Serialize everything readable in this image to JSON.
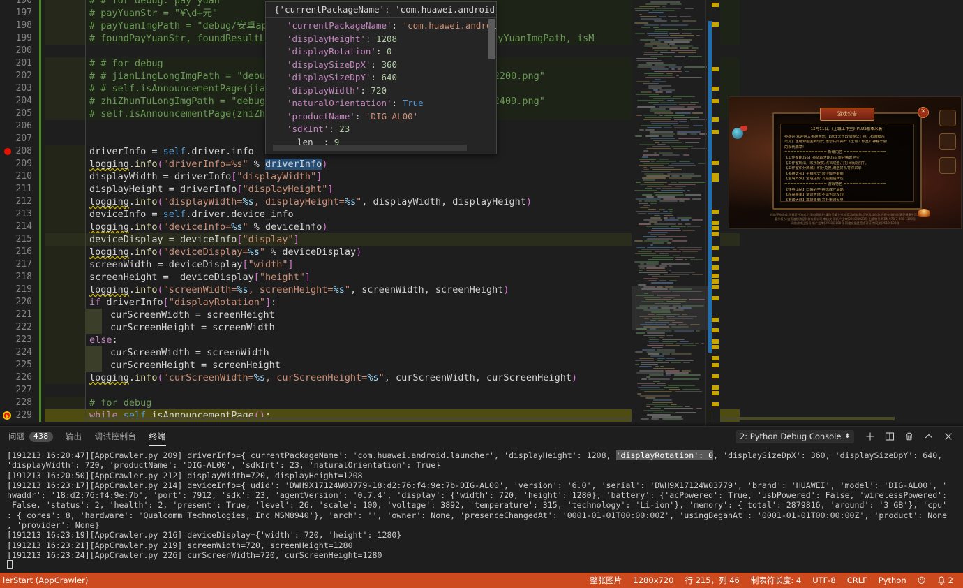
{
  "editor": {
    "first_line": 196,
    "current_line": 229,
    "breakpoint_lines": [
      208,
      229
    ],
    "lines": [
      {
        "n": 196,
        "tokens": [
          {
            "t": "# # for debug: pay yuan",
            "c": "t-comment"
          }
        ],
        "indent": 8,
        "dim": true
      },
      {
        "n": 197,
        "tokens": [
          {
            "t": "# payYuanStr = \"¥\\d+元\"",
            "c": "t-comment"
          }
        ],
        "indent": 8,
        "dim": true
      },
      {
        "n": 198,
        "tokens": [
          {
            "t": "# payYuanImgPath = \"debug/安卓app/GameName/payYuan_191212_172445.png\"",
            "c": "t-comment"
          }
        ],
        "indent": 8,
        "dim": true
      },
      {
        "n": 199,
        "tokens": [
          {
            "t": "# foundPayYuanStr, foundResultList, ocrResult = self.ocrCheck(imgPath=payYuanImgPath, isM",
            "c": "t-comment"
          }
        ],
        "indent": 8,
        "dim": true
      },
      {
        "n": 200,
        "tokens": [],
        "indent": 0
      },
      {
        "n": 201,
        "tokens": [
          {
            "t": "# # for debug",
            "c": "t-comment"
          }
        ],
        "indent": 8,
        "dim": true
      },
      {
        "n": 202,
        "tokens": [
          {
            "t": "# # jianLingLongImgPath = \"debug/安卓app/GameName/jianLingLong_191212_172200.png\"",
            "c": "t-comment"
          }
        ],
        "indent": 8,
        "dim": true
      },
      {
        "n": 203,
        "tokens": [
          {
            "t": "# # self.isAnnouncementPage(jianLingLongImgPath)",
            "c": "t-comment"
          }
        ],
        "indent": 8,
        "dim": true
      },
      {
        "n": 204,
        "tokens": [
          {
            "t": "# zhiZhunTuLongImgPath = \"debug/安卓app/GameName/zhiZhunTuLong_191213_142409.png\"",
            "c": "t-comment"
          }
        ],
        "indent": 8,
        "dim": true
      },
      {
        "n": 205,
        "tokens": [
          {
            "t": "# self.isAnnouncementPage(zhiZhunTuLongImgPath)",
            "c": "t-comment"
          }
        ],
        "indent": 8,
        "dim": true
      },
      {
        "n": 206,
        "tokens": [],
        "indent": 0
      },
      {
        "n": 207,
        "tokens": [],
        "indent": 0
      },
      {
        "n": 208,
        "tokens": [
          {
            "t": "driverInfo = ",
            "c": "t-plain"
          },
          {
            "t": "self",
            "c": "t-self"
          },
          {
            "t": ".driver.info",
            "c": "t-plain"
          }
        ],
        "indent": 8
      },
      {
        "n": 209,
        "tokens": [
          {
            "t": "logging",
            "c": "t-plain"
          },
          {
            "t": ".",
            "c": "t-plain"
          },
          {
            "t": "info",
            "c": "t-fn"
          },
          {
            "t": "(",
            "c": "t-bracket"
          },
          {
            "t": "\"driverInfo=%s\"",
            "c": "t-str"
          },
          {
            "t": " % ",
            "c": "t-plain"
          },
          {
            "t": "driverInfo",
            "c": "t-plain",
            "sel": true
          },
          {
            "t": ")",
            "c": "t-bracket"
          }
        ],
        "indent": 8
      },
      {
        "n": 210,
        "tokens": [
          {
            "t": "displayWidth = driverInfo",
            "c": "t-plain"
          },
          {
            "t": "[",
            "c": "t-bracket"
          },
          {
            "t": "\"displayWidth\"",
            "c": "t-str"
          },
          {
            "t": "]",
            "c": "t-bracket"
          }
        ],
        "indent": 8
      },
      {
        "n": 211,
        "tokens": [
          {
            "t": "displayHeight = driverInfo",
            "c": "t-plain"
          },
          {
            "t": "[",
            "c": "t-bracket"
          },
          {
            "t": "\"displayHeight\"",
            "c": "t-str"
          },
          {
            "t": "]",
            "c": "t-bracket"
          }
        ],
        "indent": 8
      },
      {
        "n": 212,
        "tokens": [
          {
            "t": "logging",
            "c": "t-plain"
          },
          {
            "t": ".",
            "c": "t-plain"
          },
          {
            "t": "info",
            "c": "t-fn"
          },
          {
            "t": "(",
            "c": "t-bracket"
          },
          {
            "t": "\"displayWidth=",
            "c": "t-str"
          },
          {
            "t": "%s",
            "c": "t-var"
          },
          {
            "t": ", displayHeight=",
            "c": "t-str"
          },
          {
            "t": "%s",
            "c": "t-var"
          },
          {
            "t": "\"",
            "c": "t-str"
          },
          {
            "t": ", displayWidth, displayHeight",
            "c": "t-plain"
          },
          {
            "t": ")",
            "c": "t-bracket"
          }
        ],
        "indent": 8
      },
      {
        "n": 213,
        "tokens": [
          {
            "t": "deviceInfo = ",
            "c": "t-plain"
          },
          {
            "t": "self",
            "c": "t-self"
          },
          {
            "t": ".driver.device_info",
            "c": "t-plain"
          }
        ],
        "indent": 8
      },
      {
        "n": 214,
        "tokens": [
          {
            "t": "logging",
            "c": "t-plain"
          },
          {
            "t": ".",
            "c": "t-plain"
          },
          {
            "t": "info",
            "c": "t-fn"
          },
          {
            "t": "(",
            "c": "t-bracket"
          },
          {
            "t": "\"deviceInfo=",
            "c": "t-str"
          },
          {
            "t": "%s",
            "c": "t-var"
          },
          {
            "t": "\"",
            "c": "t-str"
          },
          {
            "t": " % deviceInfo",
            "c": "t-plain"
          },
          {
            "t": ")",
            "c": "t-bracket"
          }
        ],
        "indent": 8
      },
      {
        "n": 215,
        "tokens": [
          {
            "t": "deviceDisplay = deviceInfo",
            "c": "t-plain"
          },
          {
            "t": "[",
            "c": "t-bracket"
          },
          {
            "t": "\"display\"",
            "c": "t-str"
          },
          {
            "t": "]",
            "c": "t-bracket"
          }
        ],
        "indent": 8,
        "cursorline": true
      },
      {
        "n": 216,
        "tokens": [
          {
            "t": "logging",
            "c": "t-plain"
          },
          {
            "t": ".",
            "c": "t-plain"
          },
          {
            "t": "info",
            "c": "t-fn"
          },
          {
            "t": "(",
            "c": "t-bracket"
          },
          {
            "t": "\"deviceDisplay=",
            "c": "t-str"
          },
          {
            "t": "%s",
            "c": "t-var"
          },
          {
            "t": "\"",
            "c": "t-str"
          },
          {
            "t": " % deviceDisplay",
            "c": "t-plain"
          },
          {
            "t": ")",
            "c": "t-bracket"
          }
        ],
        "indent": 8
      },
      {
        "n": 217,
        "tokens": [
          {
            "t": "screenWidth = deviceDisplay",
            "c": "t-plain"
          },
          {
            "t": "[",
            "c": "t-bracket"
          },
          {
            "t": "\"width\"",
            "c": "t-str"
          },
          {
            "t": "]",
            "c": "t-bracket"
          }
        ],
        "indent": 8
      },
      {
        "n": 218,
        "tokens": [
          {
            "t": "screenHeight =  deviceDisplay",
            "c": "t-plain"
          },
          {
            "t": "[",
            "c": "t-bracket"
          },
          {
            "t": "\"height\"",
            "c": "t-str"
          },
          {
            "t": "]",
            "c": "t-bracket"
          }
        ],
        "indent": 8
      },
      {
        "n": 219,
        "tokens": [
          {
            "t": "logging",
            "c": "t-plain"
          },
          {
            "t": ".",
            "c": "t-plain"
          },
          {
            "t": "info",
            "c": "t-fn"
          },
          {
            "t": "(",
            "c": "t-bracket"
          },
          {
            "t": "\"screenWidth=",
            "c": "t-str"
          },
          {
            "t": "%s",
            "c": "t-var"
          },
          {
            "t": ", screenHeight=",
            "c": "t-str"
          },
          {
            "t": "%s",
            "c": "t-var"
          },
          {
            "t": "\"",
            "c": "t-str"
          },
          {
            "t": ", screenWidth, screenHeight",
            "c": "t-plain"
          },
          {
            "t": ")",
            "c": "t-bracket"
          }
        ],
        "indent": 8
      },
      {
        "n": 220,
        "tokens": [
          {
            "t": "if",
            "c": "t-kw"
          },
          {
            "t": " driverInfo",
            "c": "t-plain"
          },
          {
            "t": "[",
            "c": "t-bracket"
          },
          {
            "t": "\"displayRotation\"",
            "c": "t-str"
          },
          {
            "t": "]",
            "c": "t-bracket"
          },
          {
            "t": ":",
            "c": "t-plain"
          }
        ],
        "indent": 8
      },
      {
        "n": 221,
        "tokens": [
          {
            "t": "curScreenWidth = screenHeight",
            "c": "t-plain"
          }
        ],
        "indent": 12
      },
      {
        "n": 222,
        "tokens": [
          {
            "t": "curScreenHeight = screenWidth",
            "c": "t-plain"
          }
        ],
        "indent": 12
      },
      {
        "n": 223,
        "tokens": [
          {
            "t": "else",
            "c": "t-kw"
          },
          {
            "t": ":",
            "c": "t-plain"
          }
        ],
        "indent": 8
      },
      {
        "n": 224,
        "tokens": [
          {
            "t": "curScreenWidth = screenWidth",
            "c": "t-plain"
          }
        ],
        "indent": 12
      },
      {
        "n": 225,
        "tokens": [
          {
            "t": "curScreenHeight = screenHeight",
            "c": "t-plain"
          }
        ],
        "indent": 12
      },
      {
        "n": 226,
        "tokens": [
          {
            "t": "logging",
            "c": "t-plain"
          },
          {
            "t": ".",
            "c": "t-plain"
          },
          {
            "t": "info",
            "c": "t-fn"
          },
          {
            "t": "(",
            "c": "t-bracket"
          },
          {
            "t": "\"curScreenWidth=",
            "c": "t-str"
          },
          {
            "t": "%s",
            "c": "t-var"
          },
          {
            "t": ", curScreenHeight=",
            "c": "t-str"
          },
          {
            "t": "%s",
            "c": "t-var"
          },
          {
            "t": "\"",
            "c": "t-str"
          },
          {
            "t": ", curScreenWidth, curScreenHeight",
            "c": "t-plain"
          },
          {
            "t": ")",
            "c": "t-bracket"
          }
        ],
        "indent": 8
      },
      {
        "n": 227,
        "tokens": [],
        "indent": 0
      },
      {
        "n": 228,
        "tokens": [
          {
            "t": "# for debug",
            "c": "t-comment"
          }
        ],
        "indent": 8
      },
      {
        "n": 229,
        "tokens": [
          {
            "t": "while",
            "c": "t-kw"
          },
          {
            "t": " ",
            "c": "t-plain"
          },
          {
            "t": "self",
            "c": "t-self"
          },
          {
            "t": ".isAnnouncementPage",
            "c": "t-plain"
          },
          {
            "t": "()",
            "c": "t-bracket"
          },
          {
            "t": ":",
            "c": "t-plain"
          }
        ],
        "indent": 8,
        "current": true
      }
    ]
  },
  "hover_tooltip": {
    "header": "{'currentPackageName': 'com.huawei.android.la…",
    "rows": [
      {
        "key": "'currentPackageName'",
        "value": "'com.huawei.android.lau",
        "type": "str"
      },
      {
        "key": "'displayHeight'",
        "value": "1208",
        "type": "num"
      },
      {
        "key": "'displayRotation'",
        "value": "0",
        "type": "num"
      },
      {
        "key": "'displaySizeDpX'",
        "value": "360",
        "type": "num"
      },
      {
        "key": "'displaySizeDpY'",
        "value": "640",
        "type": "num"
      },
      {
        "key": "'displayWidth'",
        "value": "720",
        "type": "num"
      },
      {
        "key": "'naturalOrientation'",
        "value": "True",
        "type": "bool"
      },
      {
        "key": "'productName'",
        "value": "'DIG-AL00'",
        "type": "str"
      },
      {
        "key": "'sdkInt'",
        "value": "23",
        "type": "num"
      },
      {
        "key": "__len__",
        "value": "9",
        "type": "num",
        "plainkey": true
      }
    ]
  },
  "screenshot_preview": {
    "title": "游戏公告",
    "close": "✕",
    "headline": "12月11日,《王城工作室》PLUS版本来袭!",
    "body": [
      "英雄好,欢迎进入英雄大陆!【游戏天王欧阳春华】携【石帽细宗",
      "坛月】重磅穿越回到现代,邀您共同揭开《王城工作室》神秘华丽",
      "的现代篇章!",
      "============== 新增内容 ==============",
      "【工作室BOSS】挑战四大BOSS,豪夺稀世至宝",
      "【工作室玩法】欢乐娱赏,点石成金,打打闹闹领好礼",
      "【工作室积分商城】积分兑换,赠送好礼等你来拿",
      "【英雄史书】平铺元史,奈卫疆传争霸",
      "【全境界洪】全境进阶,发掘更强属性",
      "============== 游戏特色 ==============",
      "【铁券山民】口袋必学,神炼成才最酷!",
      "【超高装率】幸运大陆,不需也能攻顶!",
      "【重磅大陆】群雄争霸,共赴重磅世界!"
    ],
    "footer": [
      "适龄不良游戏,防塞是控游戏,注意自我保护,谨防受骗上当,适度游戏益脑,沉迷游戏伤身,合理安排时间,享受健康生活。",
      "著作权人:自贡谊想游星科技有限公司 审核文号:新广出审[2018]0023号 出版物号:ISBN 978-7-498-1108号",
      "网络游戏出版号:新广出审[2018]1108号 网络文化经营许可证:京网文[2019]108号"
    ],
    "icons": [
      "加速按钮",
      "背包按钮",
      "公告按钮"
    ]
  },
  "panel": {
    "tabs": [
      {
        "label": "问题",
        "badge": "438",
        "active": false
      },
      {
        "label": "输出",
        "badge": null,
        "active": false
      },
      {
        "label": "调试控制台",
        "badge": null,
        "active": false
      },
      {
        "label": "终端",
        "badge": null,
        "active": true
      }
    ],
    "terminal_select": "2: Python Debug Console",
    "actions": [
      "new-terminal",
      "split-terminal",
      "kill-terminal",
      "maximize-panel",
      "close-panel"
    ],
    "output": [
      {
        "segments": [
          {
            "t": "[191213 16:20:47][AppCrawler.py 209] driverInfo={'currentPackageName': 'com.huawei.android.launcher', 'displayHeight': 1208, "
          },
          {
            "t": "'displayRotation': 0",
            "hl": true
          },
          {
            "t": ", 'displaySizeDpX': 360, 'displaySizeDpY': 640,"
          }
        ]
      },
      {
        "segments": [
          {
            "t": "'displayWidth': 720, 'productName': 'DIG-AL00', 'sdkInt': 23, 'naturalOrientation': True}"
          }
        ]
      },
      {
        "segments": [
          {
            "t": "[191213 16:20:50][AppCrawler.py 212] displayWidth=720, displayHeight=1208"
          }
        ]
      },
      {
        "segments": [
          {
            "t": "[191213 16:23:17][AppCrawler.py 214] deviceInfo={'udid': 'DWH9X17124W03779-18:d2:76:f4:9e:7b-DIG-AL00', 'version': '6.0', 'serial': 'DWH9X17124W03779', 'brand': 'HUAWEI', 'model': 'DIG-AL00', '"
          }
        ]
      },
      {
        "segments": [
          {
            "t": "hwaddr': '18:d2:76:f4:9e:7b', 'port': 7912, 'sdk': 23, 'agentVersion': '0.7.4', 'display': {'width': 720, 'height': 1280}, 'battery': {'acPowered': True, 'usbPowered': False, 'wirelessPowered':"
          }
        ]
      },
      {
        "segments": [
          {
            "t": " False, 'status': 2, 'health': 2, 'present': True, 'level': 26, 'scale': 100, 'voltage': 3892, 'temperature': 315, 'technology': 'Li-ion'}, 'memory': {'total': 2879816, 'around': '3 GB'}, 'cpu'"
          }
        ]
      },
      {
        "segments": [
          {
            "t": ": {'cores': 8, 'hardware': 'Qualcomm Technologies, Inc MSM8940'}, 'arch': '', 'owner': None, 'presenceChangedAt': '0001-01-01T00:00:00Z', 'usingBeganAt': '0001-01-01T00:00:00Z', 'product': None"
          }
        ]
      },
      {
        "segments": [
          {
            "t": ", 'provider': None}"
          }
        ]
      },
      {
        "segments": [
          {
            "t": "[191213 16:23:19][AppCrawler.py 216] deviceDisplay={'width': 720, 'height': 1280}"
          }
        ]
      },
      {
        "segments": [
          {
            "t": "[191213 16:23:21][AppCrawler.py 219] screenWidth=720, screenHeight=1280"
          }
        ]
      },
      {
        "segments": [
          {
            "t": "[191213 16:23:24][AppCrawler.py 226] curScreenWidth=720, curScreenHeight=1280"
          }
        ]
      },
      {
        "segments": [],
        "cursor": true
      }
    ]
  },
  "statusbar": {
    "background": "#cc4a1e",
    "left": "lerStart (AppCrawler)",
    "right_items": [
      "整张图片",
      "1280x720",
      "行 215，列 46",
      "制表符长度: 4",
      "UTF-8",
      "CRLF",
      "Python"
    ],
    "smiley": "☺",
    "bell": "🔔",
    "notification_count": "2"
  }
}
